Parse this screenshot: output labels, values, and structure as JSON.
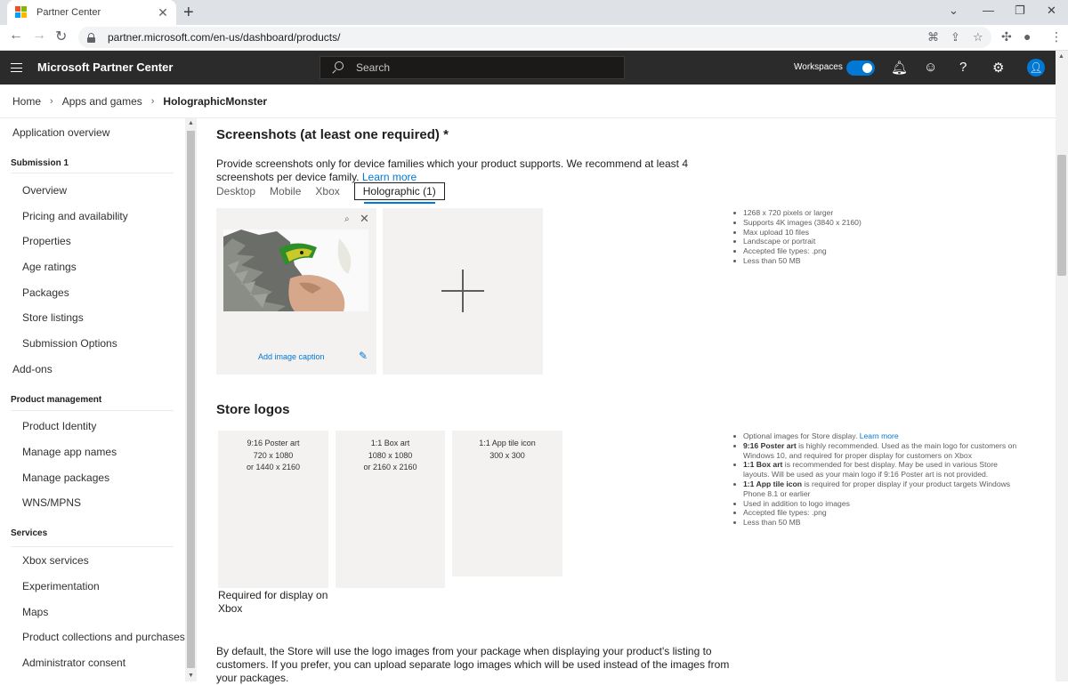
{
  "browser": {
    "tab_title": "Partner Center",
    "url": "partner.microsoft.com/en-us/dashboard/products/"
  },
  "header": {
    "app_title": "Microsoft Partner Center",
    "search_placeholder": "Search",
    "workspaces_label": "Workspaces",
    "workspaces_on": true
  },
  "breadcrumb": {
    "items": [
      "Home",
      "Apps and games"
    ],
    "current": "HolographicMonster"
  },
  "sidebar": {
    "app_overview": "Application overview",
    "submission_heading": "Submission 1",
    "submission_items": [
      "Overview",
      "Pricing and availability",
      "Properties",
      "Age ratings",
      "Packages",
      "Store listings",
      "Submission Options"
    ],
    "addons": "Add-ons",
    "product_mgmt_heading": "Product management",
    "product_mgmt_items": [
      "Product Identity",
      "Manage app names",
      "Manage packages",
      "WNS/MPNS"
    ],
    "services_heading": "Services",
    "services_items": [
      "Xbox services",
      "Experimentation",
      "Maps",
      "Product collections and purchases",
      "Administrator consent"
    ]
  },
  "screenshots": {
    "title": "Screenshots (at least one required) *",
    "desc": "Provide screenshots only for device families which your product supports. We recommend at least 4 screenshots per device family.",
    "learn_more": "Learn more",
    "tabs": [
      "Desktop",
      "Mobile",
      "Xbox"
    ],
    "active_tab": "Holographic (1)",
    "caption_link": "Add image caption",
    "requirements": [
      "1268 x 720 pixels or larger",
      "Supports 4K images (3840 x 2160)",
      "Max upload 10 files",
      "Landscape or portrait",
      "Accepted file types: .png",
      "Less than 50 MB"
    ]
  },
  "store_logos": {
    "title": "Store logos",
    "cards": [
      {
        "name": "9:16 Poster art",
        "size1": "720 x 1080",
        "size2": "or 1440 x 2160"
      },
      {
        "name": "1:1 Box art",
        "size1": "1080 x 1080",
        "size2": "or 2160 x 2160"
      },
      {
        "name": "1:1 App tile icon",
        "size1": "300 x 300",
        "size2": ""
      }
    ],
    "poster_note": "Required for display on Xbox",
    "info": {
      "optional": "Optional images for Store display.",
      "learn_more": "Learn more",
      "poster_bold": "9:16 Poster art",
      "poster_text": " is highly recommended. Used as the main logo for customers on Windows 10, and required for proper display for customers on Xbox",
      "box_bold": "1:1 Box art",
      "box_text": " is recommended for best display. May be used in various Store layouts. Will be used as your main logo if 9:16 Poster art is not provided.",
      "tile_bold": "1:1 App tile icon",
      "tile_text": " is required for proper display if your product targets Windows Phone 8.1 or earlier",
      "extra": [
        "Used in addition to logo images",
        "Accepted file types: .png",
        "Less than 50 MB"
      ]
    },
    "footer": "By default, the Store will use the logo images from your package when displaying your product's listing to customers. If you prefer, you can upload separate logo images which will be used instead of the images from your packages."
  }
}
